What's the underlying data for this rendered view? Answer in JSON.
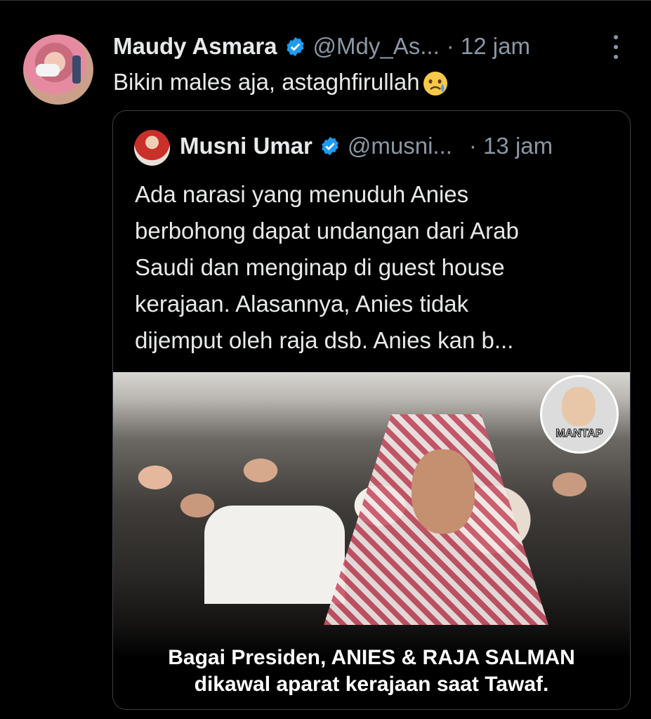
{
  "tweet": {
    "author_name": "Maudy Asmara",
    "handle": "@Mdy_As...",
    "time": "· 12 jam",
    "text": "Bikin males aja, astaghfirullah"
  },
  "quoted": {
    "author_name": "Musni Umar",
    "handle": "@musni...",
    "time": "· 13 jam",
    "text_lines": [
      "Ada narasi yang menuduh Anies",
      "berbohong  dapat undangan dari Arab",
      "Saudi dan menginap di guest house",
      "kerajaan.  Alasannya,  Anies tidak",
      "dijemput oleh raja dsb.  Anies kan b..."
    ],
    "media": {
      "badge_text": "MANTAP",
      "caption_lines": [
        "Bagai Presiden, ANIES & RAJA SALMAN",
        "dikawal aparat kerajaan saat Tawaf."
      ]
    }
  },
  "colors": {
    "background": "#000000",
    "text": "#e7e9ea",
    "muted": "#8b98a5",
    "verified": "#1d9bf0"
  }
}
